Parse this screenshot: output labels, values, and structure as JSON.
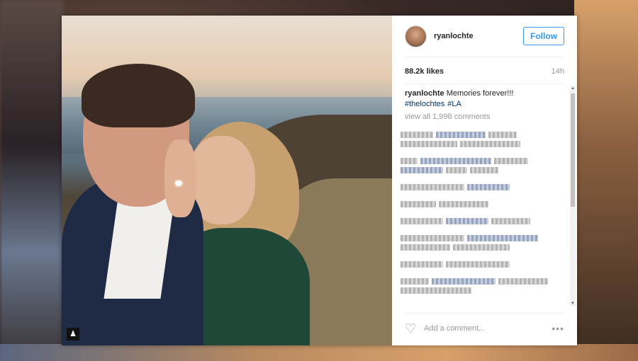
{
  "post": {
    "username": "ryanlochte",
    "follow_label": "Follow",
    "likes": "88.2k likes",
    "time": "14h",
    "caption_user": "ryanlochte",
    "caption_text": " Memories forever!!!",
    "hashtags": [
      "#thelochtes",
      "#LA"
    ],
    "view_all": "view all 1,998 comments",
    "add_comment_placeholder": "Add a comment...",
    "more_label": "•••"
  },
  "icons": {
    "heart": "heart-icon",
    "user_tag": "user-tag-icon",
    "more": "more-options-icon"
  },
  "colors": {
    "accent": "#3897f0",
    "hashtag": "#003569",
    "muted": "#999999"
  }
}
